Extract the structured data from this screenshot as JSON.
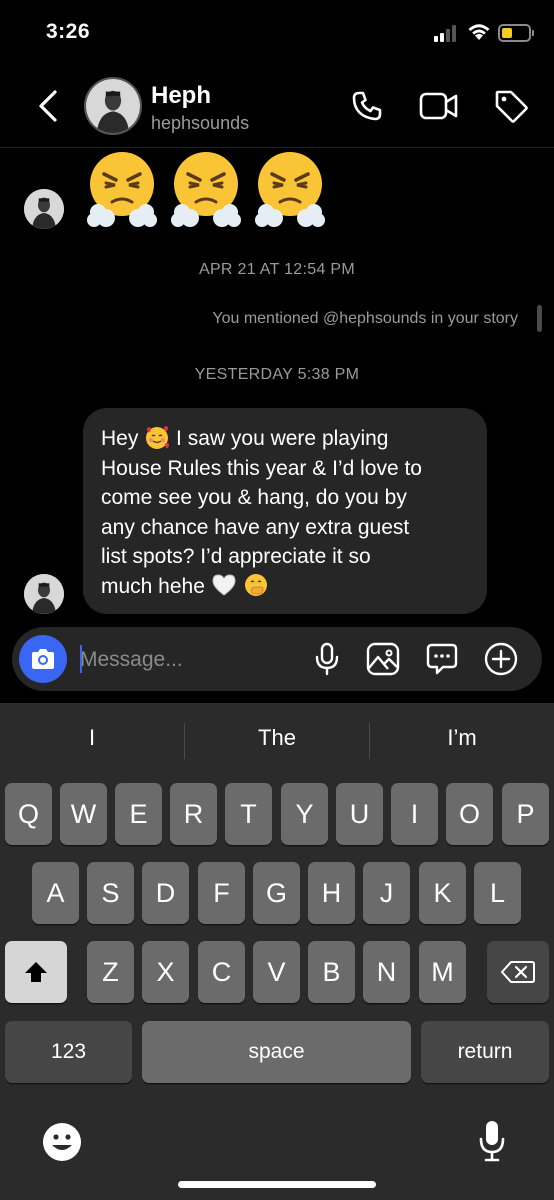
{
  "status_bar": {
    "time": "3:26",
    "battery_level": 0.4,
    "battery_color": "#f5cc1d"
  },
  "header": {
    "name": "Heph",
    "handle": "hephsounds",
    "icons": [
      "back-chevron-icon",
      "phone-icon",
      "video-camera-icon",
      "tag-icon"
    ]
  },
  "chat": {
    "emoji_row": [
      "face-with-steam-from-nose",
      "face-with-steam-from-nose",
      "face-with-steam-from-nose"
    ],
    "timestamp_1": "APR 21 AT 12:54 PM",
    "mention_note": "You mentioned @hephsounds in your story",
    "timestamp_2": "YESTERDAY 5:38 PM",
    "message": {
      "line1_a": "Hey",
      "line1_b": "I saw you were playing",
      "line2": "House Rules this year & I’d love to",
      "line3": "come see you & hang, do you by",
      "line4": "any chance have any extra guest",
      "line5": "list spots? I’d appreciate it so",
      "line6": "much hehe",
      "emojis": [
        "smiling-face-with-hearts",
        "white-heart",
        "face-with-hand-over-mouth"
      ]
    }
  },
  "composer": {
    "placeholder": "Message...",
    "icons": [
      "camera-icon",
      "microphone-icon",
      "gallery-icon",
      "sticker-icon",
      "plus-icon"
    ],
    "accent": "#3a66f4"
  },
  "keyboard": {
    "suggestions": [
      "I",
      "The",
      "I’m"
    ],
    "row1": [
      "Q",
      "W",
      "E",
      "R",
      "T",
      "Y",
      "U",
      "I",
      "O",
      "P"
    ],
    "row2": [
      "A",
      "S",
      "D",
      "F",
      "G",
      "H",
      "J",
      "K",
      "L"
    ],
    "row3": [
      "Z",
      "X",
      "C",
      "V",
      "B",
      "N",
      "M"
    ],
    "numbers_label": "123",
    "space_label": "space",
    "return_label": "return",
    "icons": [
      "shift-icon",
      "backspace-icon",
      "emoji-keyboard-icon",
      "dictation-microphone-icon"
    ]
  }
}
